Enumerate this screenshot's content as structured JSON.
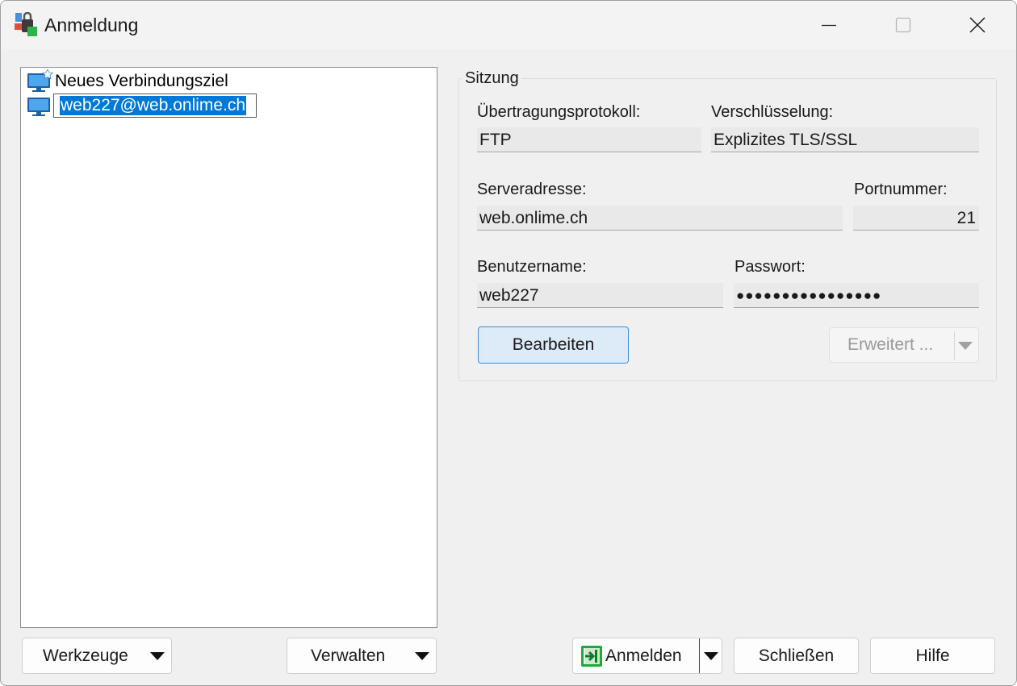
{
  "window": {
    "title": "Anmeldung"
  },
  "tree": {
    "items": [
      {
        "label": "Neues Verbindungsziel"
      },
      {
        "label": "web227@web.onlime.ch"
      }
    ]
  },
  "session": {
    "group_title": "Sitzung",
    "protocol_label": "Übertragungsprotokoll:",
    "protocol_value": "FTP",
    "encryption_label": "Verschlüsselung:",
    "encryption_value": "Explizites TLS/SSL",
    "server_label": "Serveradresse:",
    "server_value": "web.onlime.ch",
    "port_label": "Portnummer:",
    "port_value": "21",
    "user_label": "Benutzername:",
    "user_value": "web227",
    "password_label": "Passwort:",
    "password_value": "●●●●●●●●●●●●●●●●",
    "edit_button": "Bearbeiten",
    "advanced_button": "Erweitert ..."
  },
  "footer": {
    "tools_button": "Werkzeuge",
    "manage_button": "Verwalten",
    "login_button": "Anmelden",
    "close_button": "Schließen",
    "help_button": "Hilfe"
  },
  "colors": {
    "accent": "#0078d7",
    "primary_button_bg": "#dcebf7",
    "login_icon_green": "#1faa3a"
  },
  "icons": [
    "winscp-app-icon",
    "monitor-new-site-icon",
    "monitor-icon",
    "login-arrow-icon"
  ]
}
